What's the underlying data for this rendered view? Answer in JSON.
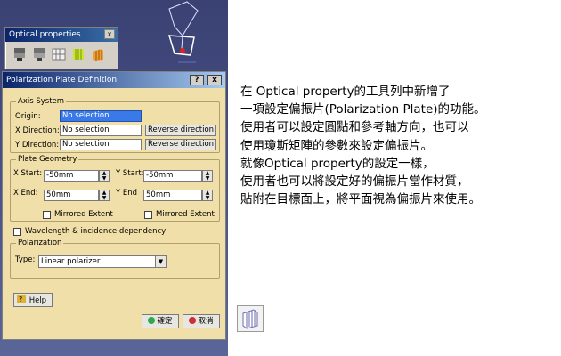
{
  "toolbar": {
    "title": "Optical properties",
    "close": "x",
    "tools": [
      {
        "icon": "optical-property-icon",
        "glyph": "🔩"
      },
      {
        "icon": "optical-property-2-icon",
        "glyph": "🔩"
      },
      {
        "icon": "grid-material-icon",
        "glyph": "▦"
      },
      {
        "icon": "green-film-icon",
        "glyph": "▥"
      },
      {
        "icon": "polarization-plate-icon",
        "glyph": "▥"
      }
    ]
  },
  "dialog": {
    "title": "Polarization Plate Definition",
    "help_glyph": "?",
    "close_glyph": "x",
    "axis_system": {
      "label": "Axis System",
      "origin_label": "Origin:",
      "origin_value": "No selection",
      "xdir_label": "X Direction:",
      "xdir_value": "No selection",
      "ydir_label": "Y Direction:",
      "ydir_value": "No selection",
      "reverse_label": "Reverse direction"
    },
    "plate_geometry": {
      "label": "Plate Geometry",
      "xstart_label": "X Start:",
      "xstart_value": "-50mm",
      "ystart_label": "Y Start:",
      "ystart_value": "-50mm",
      "xend_label": "X End:",
      "xend_value": "50mm",
      "yend_label": "Y End",
      "yend_value": "50mm",
      "mirrored_label": "Mirrored Extent"
    },
    "wavelength_label": "Wavelength & incidence dependency",
    "polarization": {
      "label": "Polarization",
      "type_label": "Type:",
      "type_value": "Linear polarizer"
    },
    "help_label": "Help",
    "ok_label": "確定",
    "cancel_label": "取消",
    "colors": {
      "ok": "#2fa84f",
      "cancel": "#d03030"
    }
  },
  "description": [
    "在 Optical property的工具列中新增了",
    "一項設定偏振片(Polarization Plate)的功能。",
    "使用者可以設定圓點和參考軸方向，也可以",
    "使用瓊斯矩陣的參數來設定偏振片。",
    "就像Optical property的設定一樣，",
    "使用者也可以將設定好的偏振片當作材質，",
    "貼附在目標面上，將平面視為偏振片來使用。"
  ]
}
